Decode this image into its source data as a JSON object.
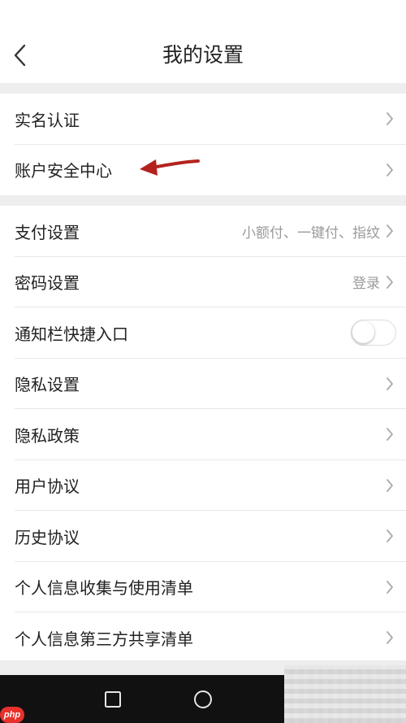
{
  "header": {
    "title": "我的设置",
    "back_icon": "chevron-left-icon"
  },
  "group1": [
    {
      "label": "实名认证",
      "value": ""
    },
    {
      "label": "账户安全中心",
      "value": ""
    }
  ],
  "group2": [
    {
      "label": "支付设置",
      "value": "小额付、一键付、指纹"
    },
    {
      "label": "密码设置",
      "value": "登录"
    },
    {
      "label": "通知栏快捷入口",
      "toggle_on": false
    },
    {
      "label": "隐私设置",
      "value": ""
    },
    {
      "label": "隐私政策",
      "value": ""
    },
    {
      "label": "用户协议",
      "value": ""
    },
    {
      "label": "历史协议",
      "value": ""
    },
    {
      "label": "个人信息收集与使用清单",
      "value": ""
    },
    {
      "label": "个人信息第三方共享清单",
      "value": ""
    }
  ],
  "annotation": {
    "arrow_color": "#b3231e",
    "points_to": "账户安全中心"
  },
  "watermark": {
    "badge_text": "php",
    "badge_color": "#e8312c"
  },
  "colors": {
    "background": "#ffffff",
    "separator": "#eeeeee",
    "text": "#222222",
    "secondary_text": "#9a9a9a",
    "navbar": "#111111"
  }
}
